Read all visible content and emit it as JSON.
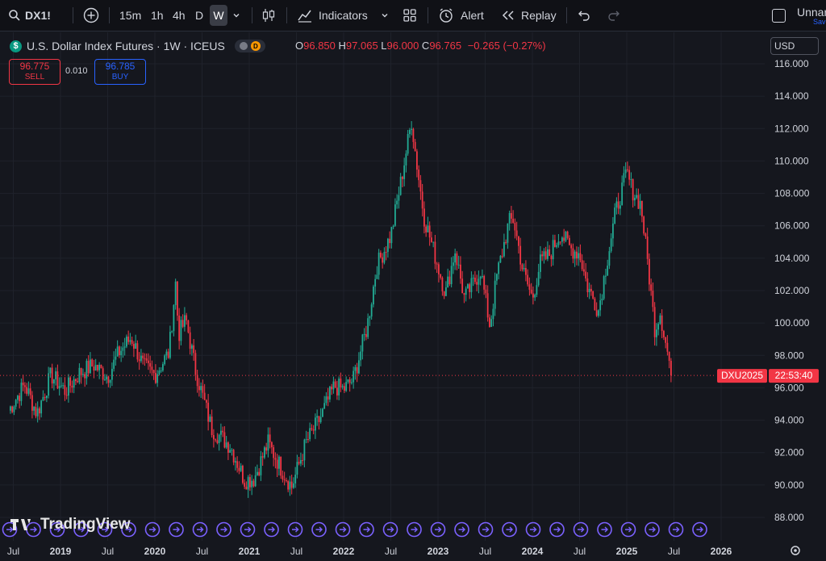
{
  "toolbar": {
    "symbol": "DX1!",
    "intervals": [
      "15m",
      "1h",
      "4h",
      "D"
    ],
    "active_interval": "W",
    "indicators_label": "Indicators",
    "alert_label": "Alert",
    "replay_label": "Replay",
    "layout_name": "Unnar",
    "save_label": "Sav"
  },
  "legend": {
    "title": "U.S. Dollar Index Futures · 1W · ICEUS",
    "badge": "D",
    "open_label": "O",
    "open": "96.850",
    "high_label": "H",
    "high": "97.065",
    "low_label": "L",
    "low": "96.000",
    "close_label": "C",
    "close": "96.765",
    "change": "−0.265 (−0.27%)"
  },
  "trade": {
    "sell_price": "96.775",
    "sell_label": "SELL",
    "spread": "0.010",
    "buy_price": "96.785",
    "buy_label": "BUY"
  },
  "currency": "USD",
  "price_tag": {
    "symbol": "DXU2025",
    "countdown": "22:53:40"
  },
  "watermark": "TradingView",
  "colors": {
    "up": "#22ab94",
    "down": "#f23645",
    "background": "#15171e",
    "accent": "#2962ff",
    "event": "#7b61ff"
  },
  "chart_data": {
    "type": "candlestick",
    "title": "U.S. Dollar Index Futures · 1W · ICEUS",
    "y_ticks": [
      "88.000",
      "90.000",
      "92.000",
      "94.000",
      "96.000",
      "98.000",
      "100.000",
      "102.000",
      "104.000",
      "106.000",
      "108.000",
      "110.000",
      "112.000",
      "114.000",
      "116.000"
    ],
    "ylim": [
      87.2,
      116.8
    ],
    "x_ticks": [
      "Jul",
      "2019",
      "Jul",
      "2020",
      "Jul",
      "2021",
      "Jul",
      "2022",
      "Jul",
      "2023",
      "Jul",
      "2024",
      "Jul",
      "2025",
      "Jul",
      "2026"
    ],
    "x_tick_values": [
      2018.5,
      2019.0,
      2019.5,
      2020.0,
      2020.5,
      2021.0,
      2021.5,
      2022.0,
      2022.5,
      2023.0,
      2023.5,
      2024.0,
      2024.5,
      2025.0,
      2025.5,
      2026.0
    ],
    "anchors": [
      [
        2018.45,
        94.6
      ],
      [
        2018.62,
        96.2
      ],
      [
        2018.75,
        94.4
      ],
      [
        2018.9,
        96.8
      ],
      [
        2019.05,
        95.8
      ],
      [
        2019.2,
        96.9
      ],
      [
        2019.35,
        97.4
      ],
      [
        2019.5,
        96.7
      ],
      [
        2019.62,
        98.2
      ],
      [
        2019.75,
        99.1
      ],
      [
        2019.88,
        97.3
      ],
      [
        2020.0,
        96.8
      ],
      [
        2020.15,
        98.2
      ],
      [
        2020.22,
        102.5
      ],
      [
        2020.25,
        99.3
      ],
      [
        2020.33,
        100.2
      ],
      [
        2020.43,
        97.1
      ],
      [
        2020.6,
        93.5
      ],
      [
        2020.8,
        92.4
      ],
      [
        2020.95,
        90.3
      ],
      [
        2021.05,
        90.4
      ],
      [
        2021.2,
        92.6
      ],
      [
        2021.35,
        90.9
      ],
      [
        2021.45,
        89.9
      ],
      [
        2021.6,
        92.6
      ],
      [
        2021.75,
        94.1
      ],
      [
        2021.9,
        96.1
      ],
      [
        2022.0,
        95.9
      ],
      [
        2022.1,
        96.5
      ],
      [
        2022.25,
        99.8
      ],
      [
        2022.35,
        103.5
      ],
      [
        2022.5,
        105.4
      ],
      [
        2022.6,
        108.5
      ],
      [
        2022.72,
        112.5
      ],
      [
        2022.76,
        110.5
      ],
      [
        2022.85,
        106.6
      ],
      [
        2023.0,
        103.5
      ],
      [
        2023.08,
        101.8
      ],
      [
        2023.18,
        104.5
      ],
      [
        2023.28,
        101.5
      ],
      [
        2023.38,
        102.5
      ],
      [
        2023.45,
        103.3
      ],
      [
        2023.55,
        99.8
      ],
      [
        2023.62,
        102.8
      ],
      [
        2023.75,
        106.2
      ],
      [
        2023.8,
        106.4
      ],
      [
        2023.9,
        103.2
      ],
      [
        2024.0,
        101.5
      ],
      [
        2024.08,
        103.7
      ],
      [
        2024.18,
        104.2
      ],
      [
        2024.3,
        105.6
      ],
      [
        2024.4,
        104.6
      ],
      [
        2024.5,
        104.3
      ],
      [
        2024.58,
        102.3
      ],
      [
        2024.7,
        100.8
      ],
      [
        2024.78,
        103.5
      ],
      [
        2024.88,
        106.8
      ],
      [
        2025.0,
        109.3
      ],
      [
        2025.05,
        108.3
      ],
      [
        2025.15,
        107.3
      ],
      [
        2025.22,
        103.8
      ],
      [
        2025.3,
        99.5
      ],
      [
        2025.35,
        100.8
      ],
      [
        2025.42,
        98.5
      ],
      [
        2025.48,
        96.765
      ]
    ],
    "last_close": 96.765
  }
}
